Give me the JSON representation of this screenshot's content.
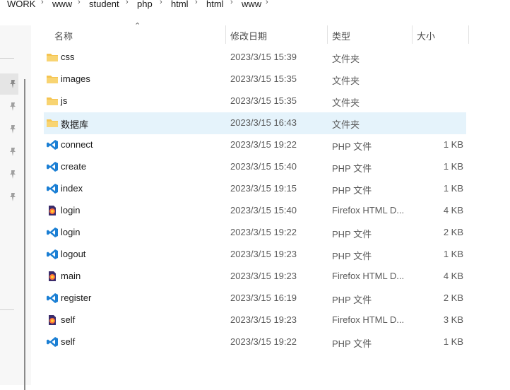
{
  "breadcrumb": [
    "WORK",
    "www",
    "student",
    "php",
    "html",
    "html",
    "www"
  ],
  "columns": {
    "name": "名称",
    "modified": "修改日期",
    "type": "类型",
    "size": "大小"
  },
  "files": [
    {
      "name": "css",
      "date": "2023/3/15 15:39",
      "type": "文件夹",
      "size": "",
      "icon": "folder-icon"
    },
    {
      "name": "images",
      "date": "2023/3/15 15:35",
      "type": "文件夹",
      "size": "",
      "icon": "folder-icon"
    },
    {
      "name": "js",
      "date": "2023/3/15 15:35",
      "type": "文件夹",
      "size": "",
      "icon": "folder-icon"
    },
    {
      "name": "数据库",
      "date": "2023/3/15 16:43",
      "type": "文件夹",
      "size": "",
      "icon": "folder-icon",
      "selected": true
    },
    {
      "name": "connect",
      "date": "2023/3/15 19:22",
      "type": "PHP 文件",
      "size": "1 KB",
      "icon": "vscode-icon"
    },
    {
      "name": "create",
      "date": "2023/3/15 15:40",
      "type": "PHP 文件",
      "size": "1 KB",
      "icon": "vscode-icon"
    },
    {
      "name": "index",
      "date": "2023/3/15 19:15",
      "type": "PHP 文件",
      "size": "1 KB",
      "icon": "vscode-icon"
    },
    {
      "name": "login",
      "date": "2023/3/15 15:40",
      "type": "Firefox HTML D...",
      "size": "4 KB",
      "icon": "firefox-html-icon"
    },
    {
      "name": "login",
      "date": "2023/3/15 19:22",
      "type": "PHP 文件",
      "size": "2 KB",
      "icon": "vscode-icon"
    },
    {
      "name": "logout",
      "date": "2023/3/15 19:23",
      "type": "PHP 文件",
      "size": "1 KB",
      "icon": "vscode-icon"
    },
    {
      "name": "main",
      "date": "2023/3/15 19:23",
      "type": "Firefox HTML D...",
      "size": "4 KB",
      "icon": "firefox-html-icon"
    },
    {
      "name": "register",
      "date": "2023/3/15 16:19",
      "type": "PHP 文件",
      "size": "2 KB",
      "icon": "vscode-icon"
    },
    {
      "name": "self",
      "date": "2023/3/15 19:23",
      "type": "Firefox HTML D...",
      "size": "3 KB",
      "icon": "firefox-html-icon"
    },
    {
      "name": "self",
      "date": "2023/3/15 19:22",
      "type": "PHP 文件",
      "size": "1 KB",
      "icon": "vscode-icon"
    }
  ],
  "colors": {
    "folder": "#f5c451",
    "vscode": "#1b7fd4",
    "firefox": "#ff7139",
    "selected": "#e5f3fb"
  }
}
